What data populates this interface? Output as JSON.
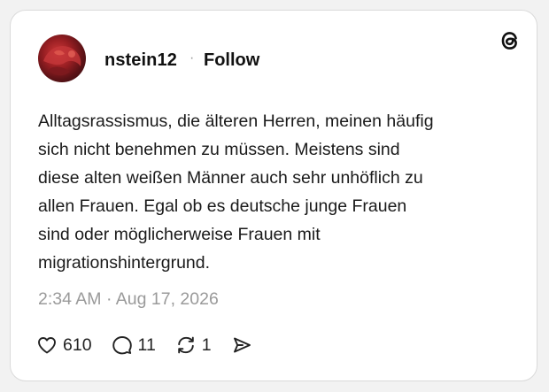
{
  "post": {
    "username": "nstein12",
    "separator": "·",
    "follow_label": "Follow",
    "text_lines": [
      "Alltagsrassismus, die älteren Herren, meinen häufig",
      "sich nicht benehmen zu müssen. Meistens sind",
      "diese alten weißen Männer auch sehr unhöflich zu",
      "allen Frauen. Egal ob es deutsche junge Frauen",
      "sind oder möglicherweise Frauen mit",
      "migrationshintergrund."
    ],
    "timestamp": "2:34 AM · Aug 17, 2026"
  },
  "actions": {
    "likes": "610",
    "replies": "11",
    "reposts": "1"
  },
  "icons": {
    "logo": "threads-logo-icon",
    "like": "heart-icon",
    "reply": "comment-icon",
    "repost": "repost-icon",
    "share": "send-icon"
  },
  "colors": {
    "text": "#111111",
    "muted": "#9a9a9a",
    "card_border": "#dadada",
    "background": "#f2f2f2"
  }
}
